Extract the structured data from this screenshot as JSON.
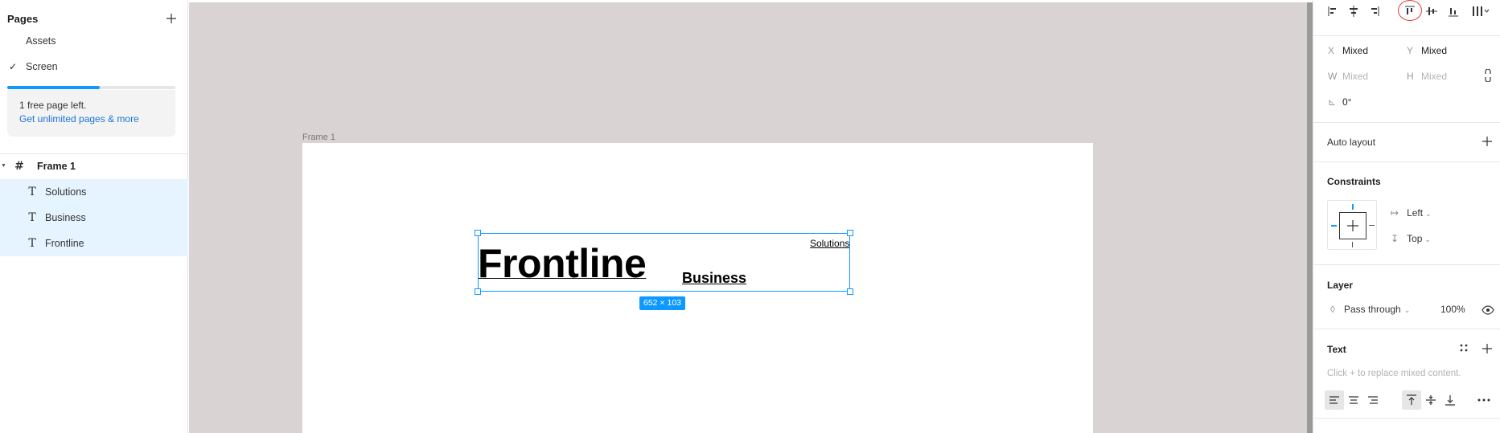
{
  "left_panel": {
    "pages_title": "Pages",
    "pages": [
      {
        "label": "Assets",
        "checked": false
      },
      {
        "label": "Screen",
        "checked": true
      }
    ],
    "page_limit_progress": 0.55,
    "upsell_text": "1 free page left.",
    "upsell_link": "Get unlimited pages & more",
    "layers": [
      {
        "label": "Frame 1",
        "icon": "frame-icon",
        "glyph": "#",
        "bold": true,
        "selected": false
      },
      {
        "label": "Solutions",
        "icon": "text-icon",
        "glyph": "T",
        "selected": true
      },
      {
        "label": "Business",
        "icon": "text-icon",
        "glyph": "T",
        "selected": true
      },
      {
        "label": "Frontline",
        "icon": "text-icon",
        "glyph": "T",
        "selected": true
      }
    ]
  },
  "canvas": {
    "frame_label": "Frame 1",
    "texts": {
      "frontline": "Frontline",
      "business": "Business",
      "solutions": "Solutions"
    },
    "selection_size": "652 × 103",
    "colors": {
      "background": "#d9d3d3",
      "selection": "#0d99ff"
    }
  },
  "right_panel": {
    "alignment_icons": [
      "align-left-icon",
      "align-horizontal-center-icon",
      "align-right-icon",
      "align-top-icon",
      "align-vertical-center-icon",
      "align-bottom-icon",
      "distribute-icon"
    ],
    "highlighted_icon": "align-top-icon",
    "x_label": "X",
    "x_value": "Mixed",
    "y_label": "Y",
    "y_value": "Mixed",
    "w_label": "W",
    "w_value": "Mixed",
    "h_label": "H",
    "h_value": "Mixed",
    "rotation": "0°",
    "auto_layout": "Auto layout",
    "constraints_title": "Constraints",
    "constraint_h": "Left",
    "constraint_v": "Top",
    "layer_title": "Layer",
    "blend_mode": "Pass through",
    "opacity": "100%",
    "text_title": "Text",
    "text_hint": "Click + to replace mixed content."
  }
}
